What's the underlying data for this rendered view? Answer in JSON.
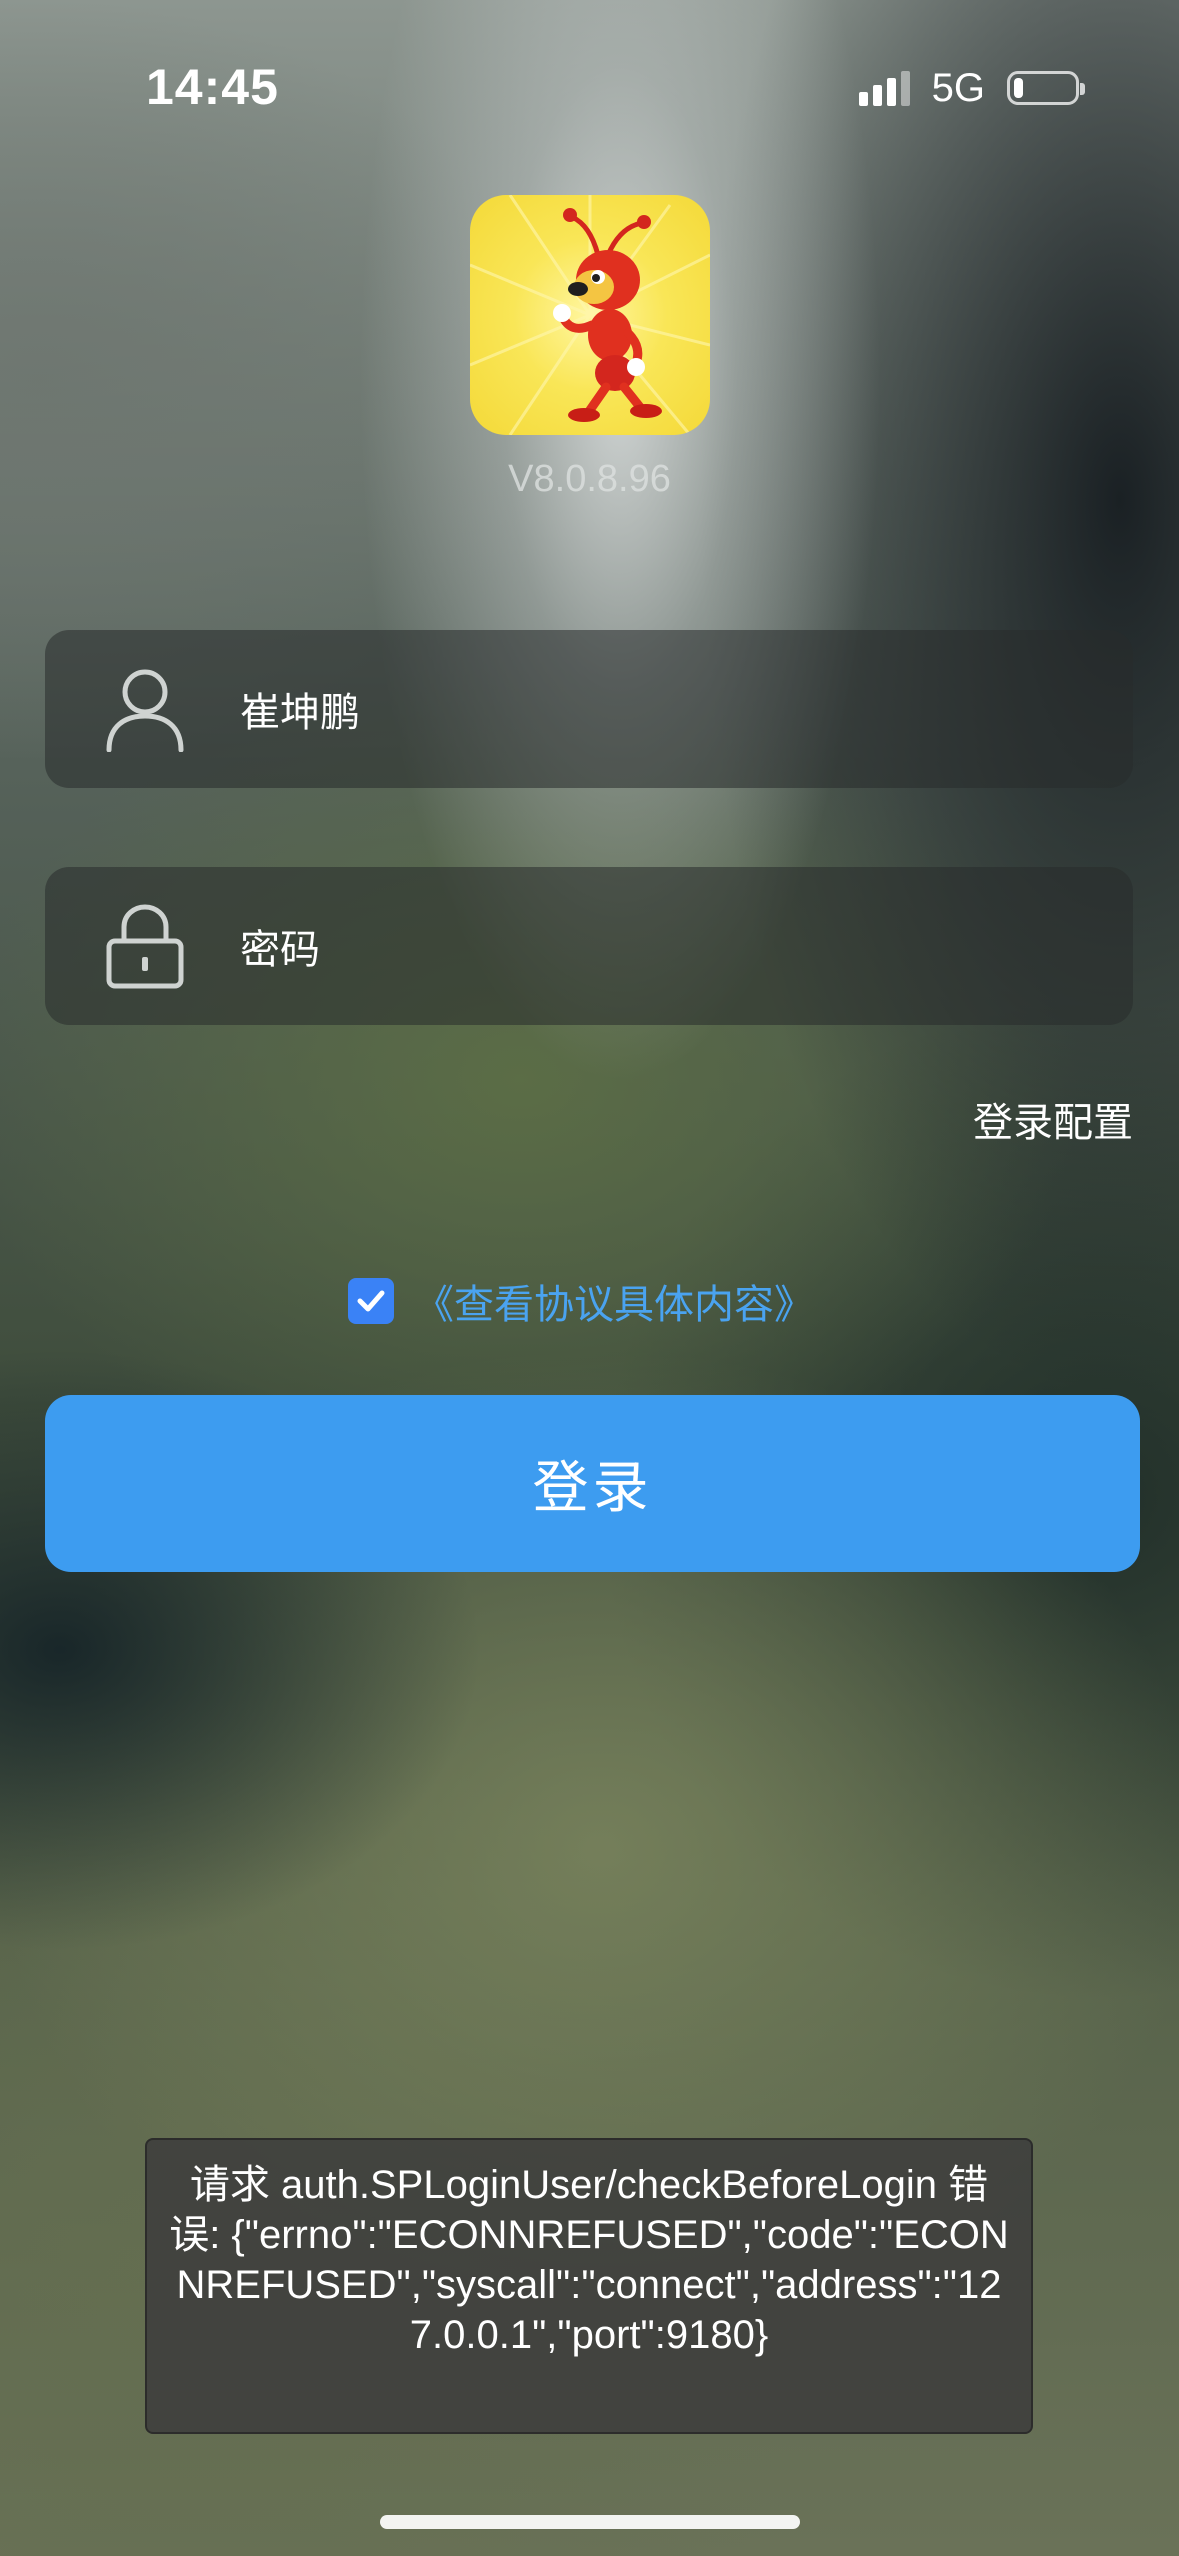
{
  "status_bar": {
    "time": "14:45",
    "network": "5G",
    "signal_bars": 3,
    "signal_bars_total": 4,
    "battery_level": 0.15
  },
  "app": {
    "version": "V8.0.8.96",
    "logo_icon": "ant-mascot-icon"
  },
  "login_form": {
    "username": {
      "icon": "user-icon",
      "value": "崔坤鹏"
    },
    "password": {
      "icon": "lock-icon",
      "placeholder": "密码",
      "value": ""
    },
    "config_link": "登录配置",
    "agreement": {
      "checked": true,
      "link_text": "《查看协议具体内容》"
    },
    "login_button": "登录"
  },
  "toast": {
    "message": "请求 auth.SPLoginUser/checkBeforeLogin 错误: {\"errno\":\"ECONNREFUSED\",\"code\":\"ECONNREFUSED\",\"syscall\":\"connect\",\"address\":\"127.0.0.1\",\"port\":9180}"
  },
  "colors": {
    "accent": "#3d9cf0",
    "link": "#4aa3f0",
    "checkbox": "#3a82f6",
    "logo_background": "#f9e657"
  }
}
